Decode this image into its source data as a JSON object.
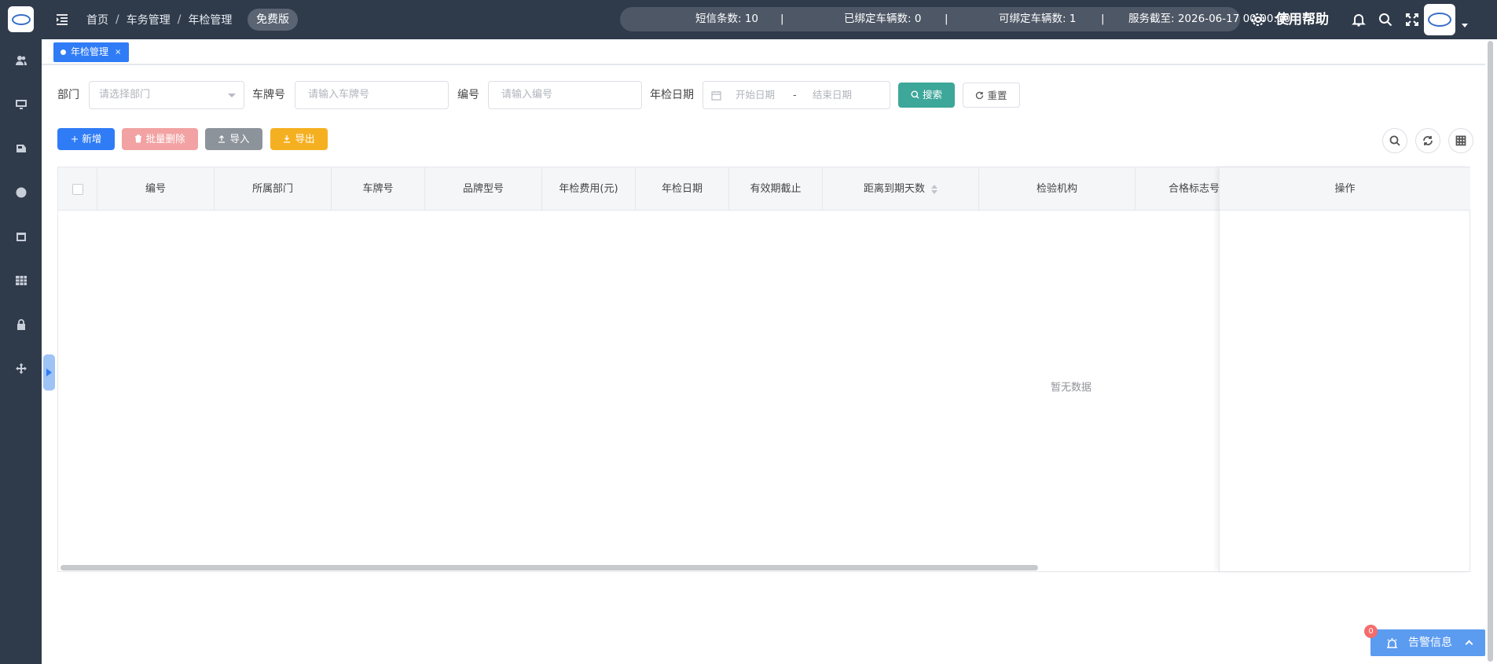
{
  "header": {
    "breadcrumb": [
      "首页",
      "车务管理",
      "年检管理"
    ],
    "breadcrumb_sep": "/",
    "edition_badge": "免费版",
    "stats": {
      "sms": "短信条数: 10",
      "bound": "已绑定车辆数: 0",
      "bindable": "可绑定车辆数: 1",
      "service": "服务截至: 2026-06-17 00:00:00",
      "divider": "|"
    },
    "help_label": "使用帮助"
  },
  "tags": {
    "active_label": "年检管理",
    "close_glyph": "×"
  },
  "filters": {
    "dept_label": "部门",
    "dept_placeholder": "请选择部门",
    "plate_label": "车牌号",
    "plate_placeholder": "请输入车牌号",
    "code_label": "编号",
    "code_placeholder": "请输入编号",
    "date_label": "年检日期",
    "date_start_placeholder": "开始日期",
    "date_sep": "-",
    "date_end_placeholder": "结束日期",
    "search_label": "搜索",
    "reset_label": "重置"
  },
  "toolbar": {
    "add_label": "+ 新增",
    "batch_delete_label": "批量删除",
    "import_label": "导入",
    "export_label": "导出"
  },
  "table": {
    "columns": [
      "编号",
      "所属部门",
      "车牌号",
      "品牌型号",
      "年检费用(元)",
      "年检日期",
      "有效期截止",
      "距离到期天数",
      "检验机构",
      "合格标志号"
    ],
    "action_column": "操作",
    "empty_text": "暂无数据"
  },
  "alarm": {
    "label": "告警信息",
    "count": "0"
  },
  "colors": {
    "sidebar": "#2f3a4b",
    "primary": "#2f7cf6",
    "search": "#3da79a",
    "danger_light": "#f2a2a2",
    "export": "#f5b021"
  }
}
